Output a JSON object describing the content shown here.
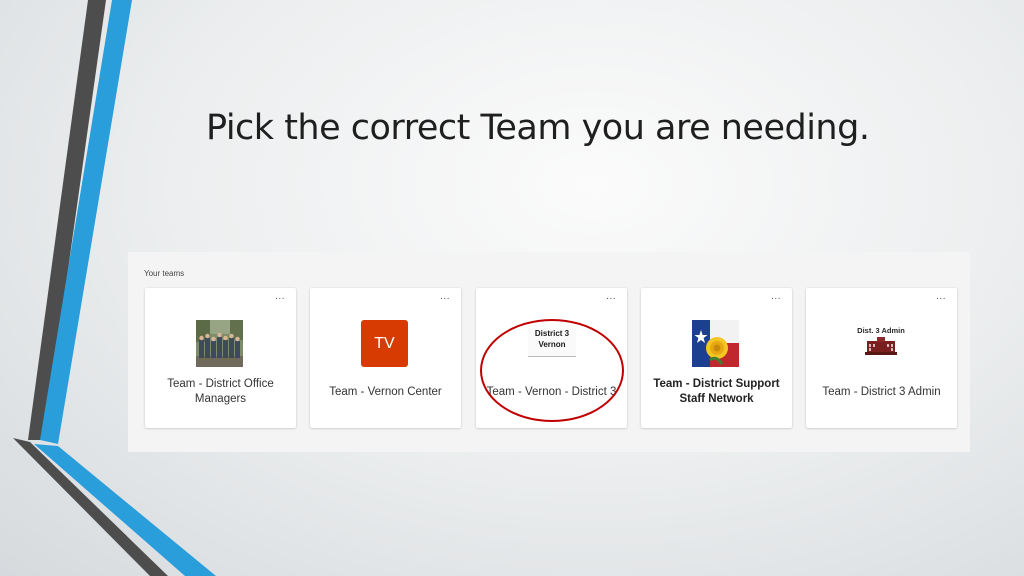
{
  "slide": {
    "title": "Pick the correct Team you are needing."
  },
  "panel": {
    "label": "Your teams"
  },
  "teams": [
    {
      "name": "Team - District Office Managers",
      "avatar": "group-photo",
      "more": "..."
    },
    {
      "name": "Team - Vernon Center",
      "avatar_text": "TV",
      "avatar_color": "#d83b01",
      "more": "..."
    },
    {
      "name": "Team - Vernon - District 3",
      "logo_line1": "District 3",
      "logo_line2": "Vernon",
      "more": "...",
      "highlighted": true,
      "highlight_color": "#c00000"
    },
    {
      "name": "Team - District Support Staff Network",
      "avatar": "texas-flag-rose",
      "more": "...",
      "bold": true
    },
    {
      "name": "Team - District 3 Admin",
      "logo_text": "Dist. 3 Admin",
      "avatar": "building-icon",
      "more": "..."
    }
  ],
  "colors": {
    "accent_blue": "#2a9ddb",
    "stripe_dark": "#4a4a4a",
    "highlight_red": "#c00000"
  }
}
